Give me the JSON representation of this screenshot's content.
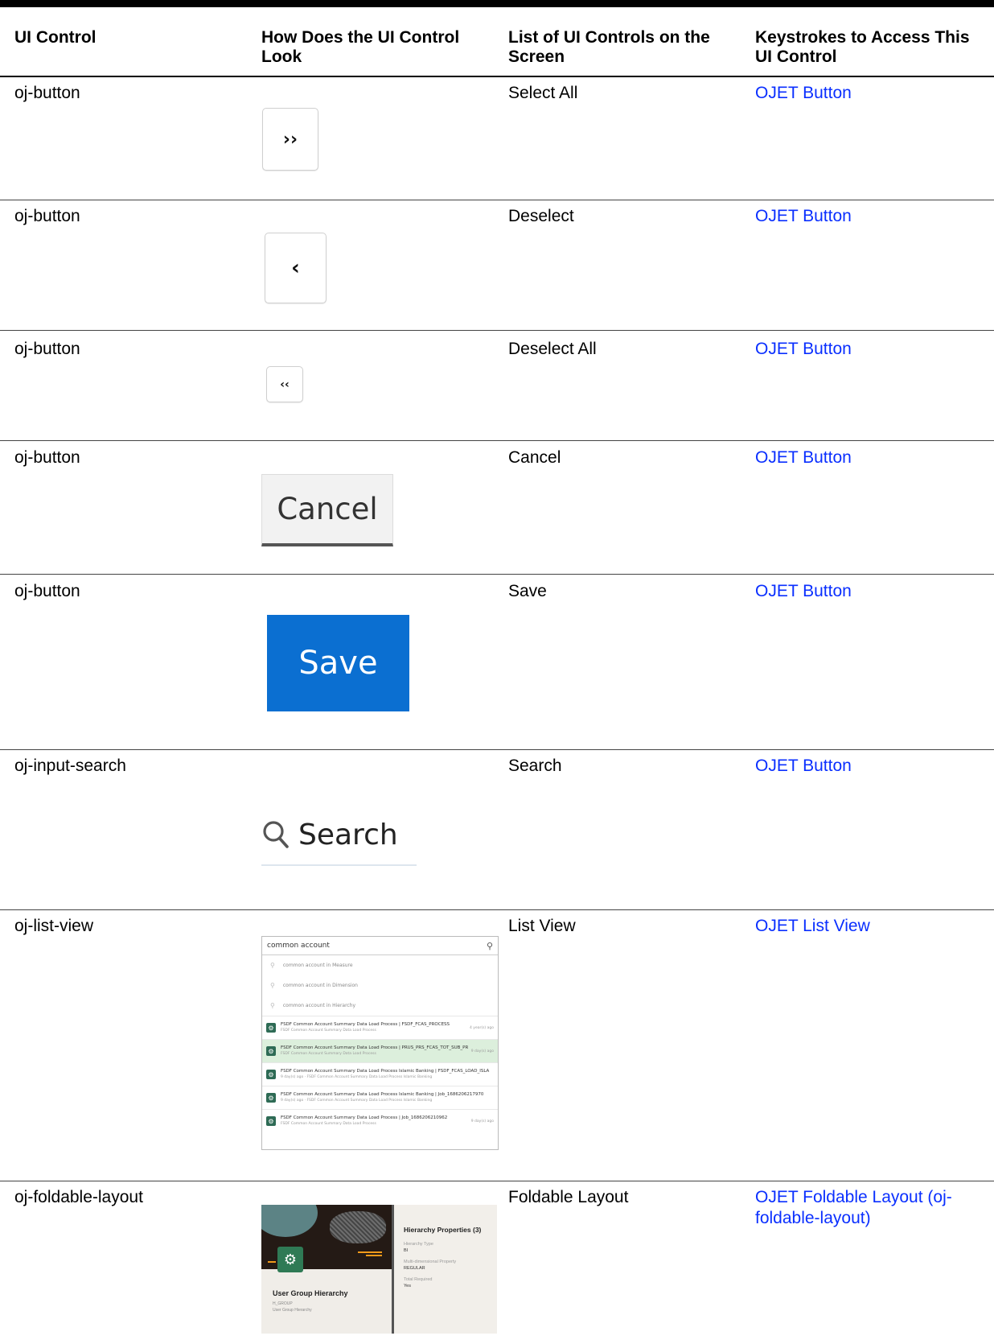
{
  "table": {
    "headers": {
      "ui_control": "UI Control",
      "look": "How Does the UI Control Look",
      "list": "List of UI Controls on the Screen",
      "keystrokes": "Keystrokes to Access This UI Control"
    },
    "rows": [
      {
        "control": "oj-button",
        "name": "Select All",
        "link": "OJET Button"
      },
      {
        "control": "oj-button",
        "name": "Deselect",
        "link": "OJET Button"
      },
      {
        "control": "oj-button",
        "name": "Deselect All",
        "link": "OJET Button"
      },
      {
        "control": "oj-button",
        "name": "Cancel",
        "link": "OJET Button"
      },
      {
        "control": "oj-button",
        "name": "Save",
        "link": "OJET Button"
      },
      {
        "control": "oj-input-search",
        "name": "Search",
        "link": "OJET Button"
      },
      {
        "control": "oj-list-view",
        "name": "List View",
        "link": "OJET List View"
      },
      {
        "control": "oj-foldable-layout",
        "name": "Foldable Layout",
        "link": "OJET Foldable Layout (oj-foldable-layout)"
      }
    ]
  },
  "previews": {
    "select_all_glyph": "››",
    "deselect_glyph": "‹",
    "deselect_all_glyph": "‹‹",
    "cancel_label": "Cancel",
    "save_label": "Save",
    "search_label": "Search",
    "list_view": {
      "input_value": "common account",
      "suggestions": [
        "common account in Measure",
        "common account in Dimension",
        "common account in Hierarchy"
      ],
      "items": [
        {
          "title": "FSDF Common Account Summary Data Load Process | FSDF_FCAS_PROCESS",
          "sub": "FSDF Common Account Summary Data Load Process",
          "age": "4 year(s) ago"
        },
        {
          "title": "FSDF Common Account Summary Data Load Process | PRUS_PRS_FCAS_TOT_SUB_PR",
          "sub": "FSDF Common Account Summary Data Load Process",
          "age": "9 day(s) ago"
        },
        {
          "title": "FSDF Common Account Summary Data Load Process Islamic Banking | FSDF_FCAS_LOAD_ISLA",
          "sub": "9 day(s) ago · FSDF Common Account Summary Data Load Process Islamic Banking",
          "age": ""
        },
        {
          "title": "FSDF Common Account Summary Data Load Process Islamic Banking | Job_1686206217970",
          "sub": "9 day(s) ago · FSDF Common Account Summary Data Load Process Islamic Banking",
          "age": ""
        },
        {
          "title": "FSDF Common Account Summary Data Load Process | Job_1686206210962",
          "sub": "FSDF Common Account Summary Data Load Process",
          "age": "9 day(s) ago"
        }
      ]
    },
    "foldable": {
      "title": "User Group Hierarchy",
      "code": "H_GROUP",
      "subtitle": "User Group Hierarchy",
      "panel_title": "Hierarchy Properties (3)",
      "props": [
        {
          "label": "Hierarchy Type",
          "value": "BI"
        },
        {
          "label": "Multi-dimensional Property",
          "value": "REGULAR"
        },
        {
          "label": "Total Required",
          "value": "Yes"
        }
      ]
    }
  },
  "colors": {
    "link": "#0a2fff",
    "save_bg": "#0b6fd1",
    "selected_row": "#dcefdc",
    "badge": "#2f7a55"
  }
}
